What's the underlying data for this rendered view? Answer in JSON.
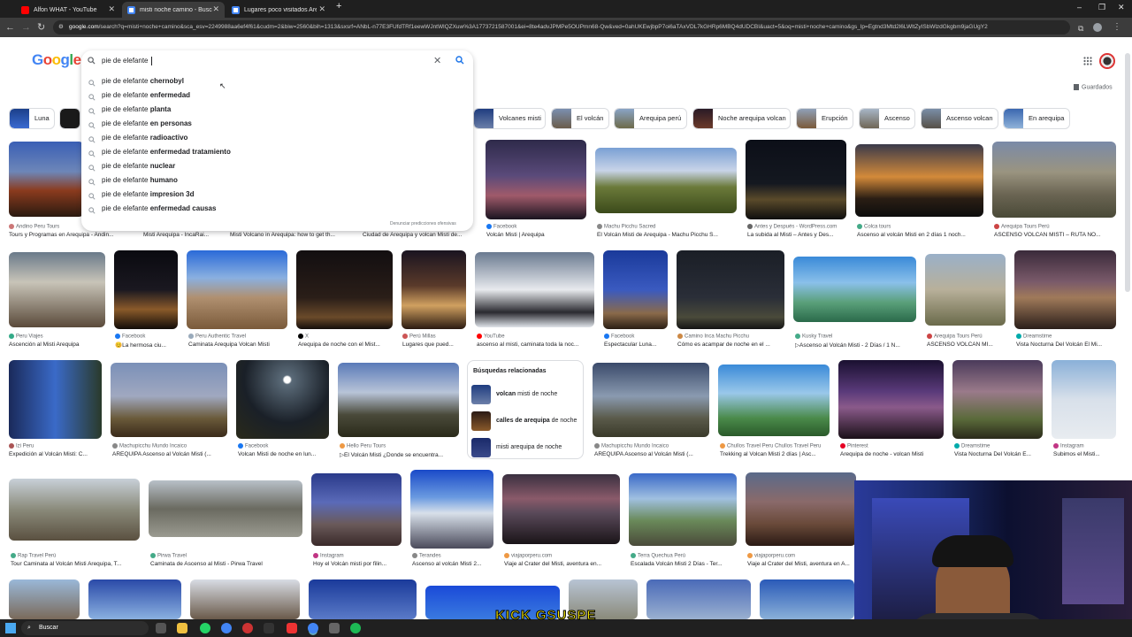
{
  "browser": {
    "tabs": [
      {
        "title": "Alfon WHAT - YouTube",
        "active": false,
        "favicon_color": "#ff0000"
      },
      {
        "title": "misti noche camino - Buscar co",
        "active": true,
        "favicon_color": "#4285f4"
      },
      {
        "title": "Lugares poco visitados Arequip",
        "active": false,
        "favicon_color": "#4285f4"
      }
    ],
    "new_tab": "+",
    "window_controls": [
      "–",
      "❐",
      "✕"
    ],
    "url_host": "google.com",
    "url_path": "/search?q=misti+noche+camino&sca_esv=2249988aa6ef4f61&cudm=2&biw=2560&bih=1313&sxsrf=ANbL-n77E3FUfdTRf1eewWJntWlQZXuw%3A1773721587001&ei=8te4advJPMPe5OUPmn68-Qw&ved=0ahUKEwjbpP7oi6aTAxVDL7kGHRp6MBQ4dUDCBI&uact=5&oq=misti+noche+camino&gs_lp=Egtnd3Mtd2l6LWltZyISbWlzdGkgbm9jaGUgY2"
  },
  "google": {
    "logo": [
      "G",
      "o",
      "o",
      "g",
      "l",
      "e"
    ],
    "logo_colors": [
      "#4285f4",
      "#ea4335",
      "#fbbc05",
      "#4285f4",
      "#34a853",
      "#ea4335"
    ],
    "query": "pie de elefante",
    "suggestions": [
      {
        "prefix": "pie de elefante ",
        "bold": "chernobyl"
      },
      {
        "prefix": "pie de elefante ",
        "bold": "enfermedad"
      },
      {
        "prefix": "pie de elefante ",
        "bold": "planta"
      },
      {
        "prefix": "pie de elefante ",
        "bold": "en personas"
      },
      {
        "prefix": "pie de elefante ",
        "bold": "radioactivo"
      },
      {
        "prefix": "pie de elefante ",
        "bold": "enfermedad tratamiento"
      },
      {
        "prefix": "pie de elefante ",
        "bold": "nuclear"
      },
      {
        "prefix": "pie de elefante ",
        "bold": "humano"
      },
      {
        "prefix": "pie de elefante ",
        "bold": "impresion 3d"
      },
      {
        "prefix": "pie de elefante ",
        "bold": "enfermedad causas"
      }
    ],
    "report_link": "Denunciar predicciones ofensivas",
    "saved_label": "Guardados"
  },
  "chips": [
    "Luna",
    "Volcanes misti",
    "El volcán",
    "Arequipa perú",
    "Noche arequipa volcan",
    "Erupción",
    "Ascenso",
    "Ascenso volcan",
    "En arequipa"
  ],
  "results_row1": [
    {
      "source": "Andino Peru Tours",
      "caption": "Tours y Programas en Arequipa - Andin..."
    },
    {
      "source": "",
      "caption": "Misti Arequipa - IncaRai..."
    },
    {
      "source": "",
      "caption": "Misti Volcano in Arequipa: how to get th..."
    },
    {
      "source": "",
      "caption": "Ciudad de Arequipa y volcan Misti de..."
    },
    {
      "source": "Facebook",
      "caption": "Volcán Misti | Arequipa"
    },
    {
      "source": "Machu Picchu Sacred",
      "caption": "El Volcán Misti de Arequipa - Machu Picchu S..."
    },
    {
      "source": "Antes y Después - WordPress.com",
      "caption": "La subida al Misti – Antes y Des..."
    },
    {
      "source": "Colca tours",
      "caption": "Ascenso al volcán Misti en 2 días 1 noch..."
    },
    {
      "source": "Arequipa Tours Perú",
      "caption": "ASCENSO VOLCAN MISTI – RUTA NO..."
    }
  ],
  "results_row2": [
    {
      "source": "Peru Viajes",
      "caption": "Ascención al Misti Arequipa"
    },
    {
      "source": "Facebook",
      "caption": "😊La hermosa ciu..."
    },
    {
      "source": "Peru Authentic Travel",
      "caption": "Caminata Arequipa Volcan Misti"
    },
    {
      "source": "X",
      "caption": "Arequipa de noche con el Mist..."
    },
    {
      "source": "Perú Millas",
      "caption": "Lugares que pued..."
    },
    {
      "source": "YouTube",
      "caption": "ascenso al misti, caminata toda la noc..."
    },
    {
      "source": "Facebook",
      "caption": "Espectacular Luna..."
    },
    {
      "source": "Camino Inca Machu Picchu",
      "caption": "Cómo es acampar de noche en el ..."
    },
    {
      "source": "Kusky Travel",
      "caption": "▷Ascenso al Volcán Misti - 2 Días / 1 N..."
    },
    {
      "source": "Arequipa Tours Perú",
      "caption": "ASCENSO VOLCAN MI..."
    },
    {
      "source": "Dreamstime",
      "caption": "Vista Nocturna Del Volcán El Mi..."
    }
  ],
  "results_row3": [
    {
      "source": "Izi Peru",
      "caption": "Expedición al Volcán Misti: C..."
    },
    {
      "source": "Machupicchu Mundo Incaico",
      "caption": "AREQUIPA Ascenso al Volcán Misti (..."
    },
    {
      "source": "Facebook",
      "caption": "Volcan Misti de noche en lun..."
    },
    {
      "source": "Hello Peru Tours",
      "caption": "▷El Volcán Misti ¿Donde se encuentra..."
    },
    {
      "source": "Machupicchu Mundo Incaico",
      "caption": "AREQUIPA Ascenso al Volcán Misti (..."
    },
    {
      "source": "Chullos Travel Peru Chullos Travel Peru",
      "caption": "Trekking al Volcan Misti 2 días | Asc..."
    },
    {
      "source": "Pinterest",
      "caption": "Arequipa de noche - volcan Misti"
    },
    {
      "source": "Dreamstime",
      "caption": "Vista Nocturna Del Volcán E..."
    },
    {
      "source": "Instagram",
      "caption": "Subimos el Misti..."
    }
  ],
  "related": {
    "title": "Búsquedas relacionadas",
    "items": [
      {
        "bold": "volcan",
        "rest": " misti de noche"
      },
      {
        "bold": "calles de arequipa",
        "rest": " de noche"
      },
      {
        "bold": "",
        "rest": "misti arequipa de noche"
      }
    ]
  },
  "results_row4": [
    {
      "source": "Rap Travel Perú",
      "caption": "Tour Caminata al Volcán Misti Arequipa, T..."
    },
    {
      "source": "Pirwa Travel",
      "caption": "Caminata de Ascenso al Misti - Pirwa Travel"
    },
    {
      "source": "Instagram",
      "caption": "Hoy el Volcán misti por filin..."
    },
    {
      "source": "Terandes",
      "caption": "Ascenso al volcán Misti 2..."
    },
    {
      "source": "viajaporperu.com",
      "caption": "Viaje al Crater del Misti, aventura en..."
    },
    {
      "source": "Terra Quechua Perú",
      "caption": "Escalada Volcán Misti 2 Días - Ter..."
    },
    {
      "source": "viajaporperu.com",
      "caption": "Viaje al Crater del Misti, aventura en A..."
    }
  ],
  "overlay_text": "KICK GSUSPE",
  "taskbar": {
    "search_label": "Buscar"
  }
}
